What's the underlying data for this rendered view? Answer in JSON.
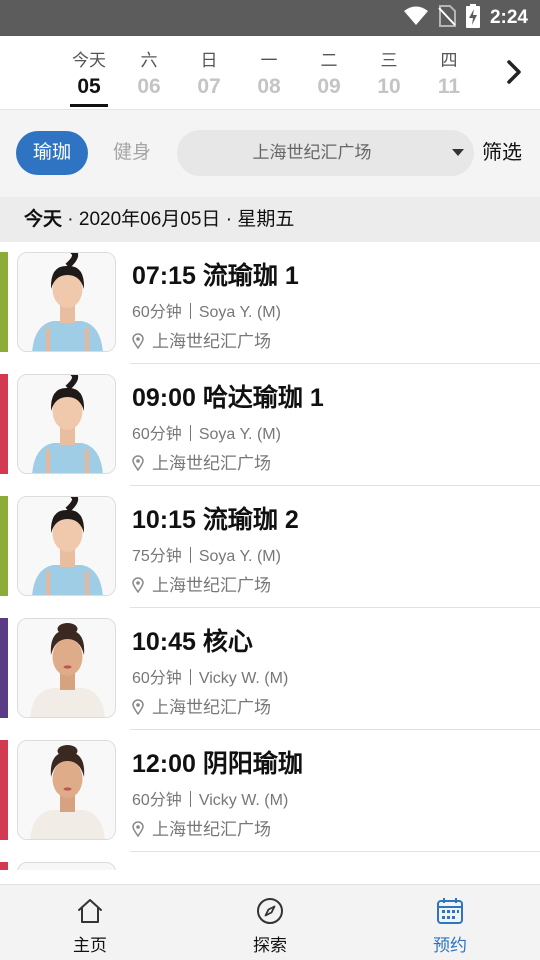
{
  "status_bar": {
    "time": "2:24",
    "icons": [
      "wifi-icon",
      "no-sim-icon",
      "battery-charging-icon"
    ]
  },
  "date_strip": {
    "days": [
      {
        "weekday": "今天",
        "date": "05",
        "active": true
      },
      {
        "weekday": "六",
        "date": "06",
        "active": false
      },
      {
        "weekday": "日",
        "date": "07",
        "active": false
      },
      {
        "weekday": "一",
        "date": "08",
        "active": false
      },
      {
        "weekday": "二",
        "date": "09",
        "active": false
      },
      {
        "weekday": "三",
        "date": "10",
        "active": false
      },
      {
        "weekday": "四",
        "date": "11",
        "active": false
      }
    ],
    "next_icon": "chevron-right-icon"
  },
  "filters": {
    "tab_yoga": "瑜珈",
    "tab_fitness": "健身",
    "location_selected": "上海世纪汇广场",
    "filter_label": "筛选"
  },
  "date_header": {
    "today": "今天",
    "rest": " · 2020年06月05日 · 星期五"
  },
  "classes": [
    {
      "time": "07:15",
      "name": "流瑜珈 1",
      "duration": "60分钟",
      "instructor": "Soya Y. (M)",
      "location": "上海世纪汇广场",
      "color": "#8dab3a",
      "avatar": "soya"
    },
    {
      "time": "09:00",
      "name": "哈达瑜珈 1",
      "duration": "60分钟",
      "instructor": "Soya Y. (M)",
      "location": "上海世纪汇广场",
      "color": "#d23a52",
      "avatar": "soya"
    },
    {
      "time": "10:15",
      "name": "流瑜珈 2",
      "duration": "75分钟",
      "instructor": "Soya Y. (M)",
      "location": "上海世纪汇广场",
      "color": "#8dab3a",
      "avatar": "soya"
    },
    {
      "time": "10:45",
      "name": "核心",
      "duration": "60分钟",
      "instructor": "Vicky W. (M)",
      "location": "上海世纪汇广场",
      "color": "#5c3b86",
      "avatar": "vicky"
    },
    {
      "time": "12:00",
      "name": "阴阳瑜珈",
      "duration": "60分钟",
      "instructor": "Vicky W. (M)",
      "location": "上海世纪汇广场",
      "color": "#d23a52",
      "avatar": "vicky"
    },
    {
      "time": "",
      "name": "",
      "duration": "",
      "instructor": "",
      "location": "",
      "color": "#d23a52",
      "avatar": "none"
    }
  ],
  "bottom_nav": [
    {
      "label": "主页",
      "icon": "home-icon",
      "active": false
    },
    {
      "label": "探索",
      "icon": "compass-icon",
      "active": false
    },
    {
      "label": "预约",
      "icon": "calendar-icon",
      "active": true
    }
  ],
  "colors": {
    "accent": "#2e74c3",
    "green": "#8dab3a",
    "red": "#d23a52",
    "purple": "#5c3b86"
  }
}
